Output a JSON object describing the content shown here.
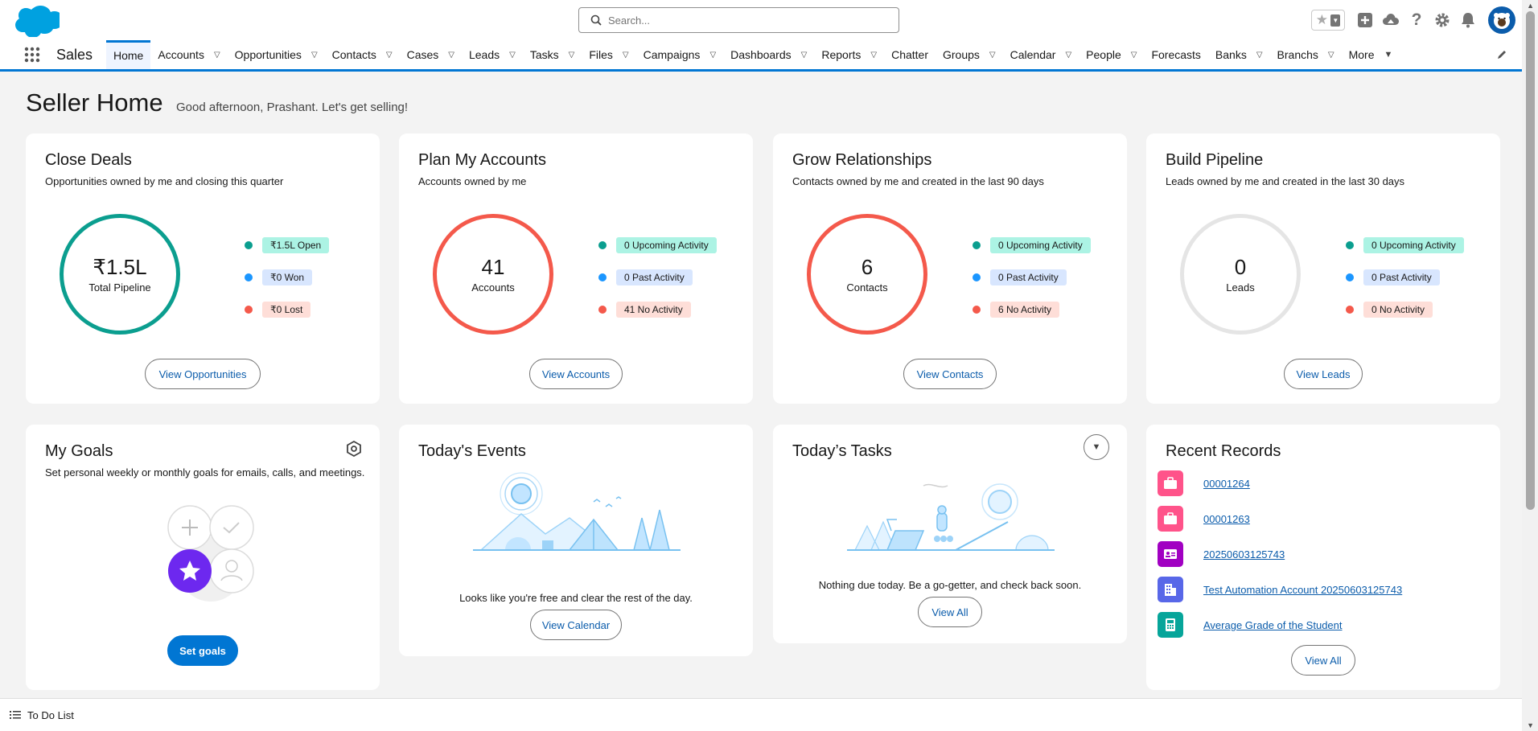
{
  "header": {
    "search_placeholder": "Search...",
    "icons": [
      "favorites-star-icon",
      "favorites-menu-icon",
      "global-add-icon",
      "trailhead-icon",
      "help-icon",
      "setup-gear-icon",
      "notifications-bell-icon",
      "user-avatar"
    ]
  },
  "nav": {
    "app_name": "Sales",
    "items": [
      {
        "label": "Home",
        "active": true
      },
      {
        "label": "Accounts",
        "menu": true
      },
      {
        "label": "Opportunities",
        "menu": true
      },
      {
        "label": "Contacts",
        "menu": true
      },
      {
        "label": "Cases",
        "menu": true
      },
      {
        "label": "Leads",
        "menu": true
      },
      {
        "label": "Tasks",
        "menu": true
      },
      {
        "label": "Files",
        "menu": true
      },
      {
        "label": "Campaigns",
        "menu": true
      },
      {
        "label": "Dashboards",
        "menu": true
      },
      {
        "label": "Reports",
        "menu": true
      },
      {
        "label": "Chatter",
        "menu": false
      },
      {
        "label": "Groups",
        "menu": true
      },
      {
        "label": "Calendar",
        "menu": true
      },
      {
        "label": "People",
        "menu": true
      },
      {
        "label": "Forecasts",
        "menu": false
      },
      {
        "label": "Banks",
        "menu": true
      },
      {
        "label": "Branchs",
        "menu": true
      },
      {
        "label": "More",
        "menu": true
      }
    ]
  },
  "page": {
    "title": "Seller Home",
    "greeting": "Good afternoon, Prashant. Let's get selling!"
  },
  "cards": {
    "close_deals": {
      "title": "Close Deals",
      "subtitle": "Opportunities owned by me and closing this quarter",
      "value": "₹1.5L",
      "value_label": "Total Pipeline",
      "legend": [
        "₹1.5L Open",
        "₹0 Won",
        "₹0 Lost"
      ],
      "button": "View Opportunities"
    },
    "plan_accounts": {
      "title": "Plan My Accounts",
      "subtitle": "Accounts owned by me",
      "value": "41",
      "value_label": "Accounts",
      "legend": [
        "0 Upcoming Activity",
        "0 Past Activity",
        "41 No Activity"
      ],
      "button": "View Accounts"
    },
    "grow_relationships": {
      "title": "Grow Relationships",
      "subtitle": "Contacts owned by me and created in the last 90 days",
      "value": "6",
      "value_label": "Contacts",
      "legend": [
        "0 Upcoming Activity",
        "0 Past Activity",
        "6 No Activity"
      ],
      "button": "View Contacts"
    },
    "build_pipeline": {
      "title": "Build Pipeline",
      "subtitle": "Leads owned by me and created in the last 30 days",
      "value": "0",
      "value_label": "Leads",
      "legend": [
        "0 Upcoming Activity",
        "0 Past Activity",
        "0 No Activity"
      ],
      "button": "View Leads"
    },
    "my_goals": {
      "title": "My Goals",
      "subtitle": "Set personal weekly or monthly goals for emails, calls, and meetings.",
      "button": "Set goals"
    },
    "todays_events": {
      "title": "Today's Events",
      "message": "Looks like you're free and clear the rest of the day.",
      "button": "View Calendar"
    },
    "todays_tasks": {
      "title": "Today’s Tasks",
      "message": "Nothing due today. Be a go-getter, and check back soon.",
      "button": "View All"
    },
    "recent_records": {
      "title": "Recent Records",
      "items": [
        {
          "label": "00001264",
          "icon": "case-icon",
          "color": "#ff538a"
        },
        {
          "label": "00001263",
          "icon": "case-icon",
          "color": "#ff538a"
        },
        {
          "label": "20250603125743",
          "icon": "contact-card-icon",
          "color": "#a100c2"
        },
        {
          "label": "Test Automation Account 20250603125743",
          "icon": "account-building-icon",
          "color": "#5867e8"
        },
        {
          "label": "Average Grade of the Student",
          "icon": "calculator-icon",
          "color": "#06a59a"
        }
      ],
      "button": "View All"
    }
  },
  "colors": {
    "brand": "#0176d3",
    "teal": "#0b9e8f",
    "coral": "#f4594b",
    "blue_dot": "#1b96ff",
    "grey_ring": "#e5e5e5",
    "pill_green": "#acf3e4",
    "pill_blue": "#d8e6fe",
    "pill_red": "#feded8"
  },
  "footer": {
    "todo_label": "To Do List"
  }
}
